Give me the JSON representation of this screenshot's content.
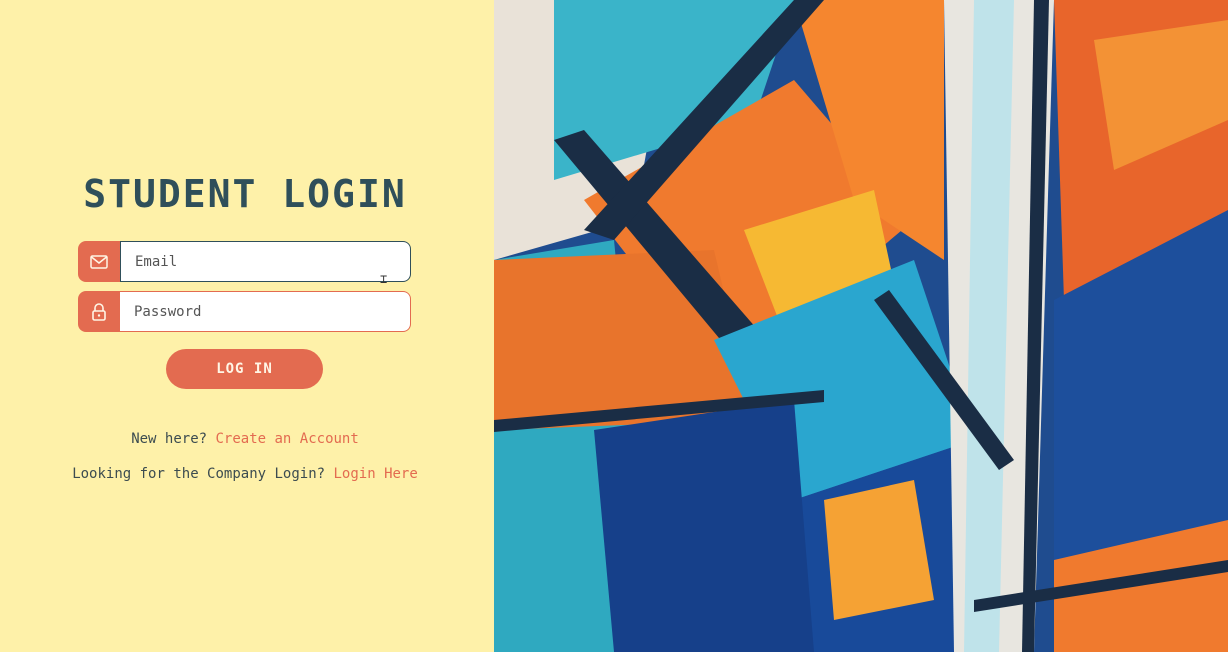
{
  "login": {
    "title": "STUDENT LOGIN",
    "email_placeholder": "Email",
    "password_placeholder": "Password",
    "login_button": "LOG IN",
    "signup_prompt": "New here?",
    "signup_link": "Create an Account",
    "company_prompt": "Looking for the Company Login?",
    "company_link": "Login Here"
  },
  "icons": {
    "email": "envelope-icon",
    "password": "lock-icon"
  },
  "colors": {
    "background": "#fef1a9",
    "accent": "#e36b50",
    "title": "#2f4f5a"
  }
}
